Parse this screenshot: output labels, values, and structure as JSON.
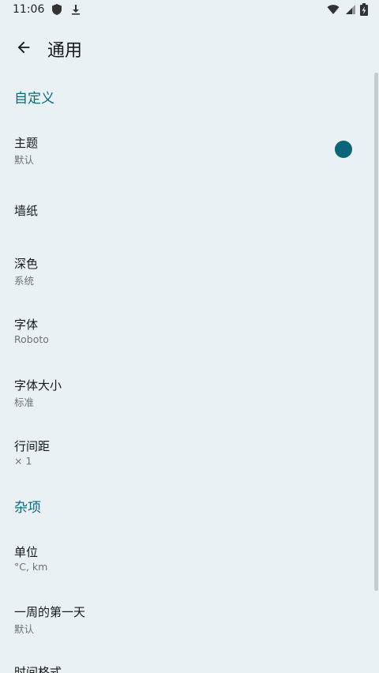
{
  "status_bar": {
    "time": "11:06",
    "icons": [
      "shield-icon",
      "download-icon",
      "wifi-icon",
      "signal-icon",
      "battery-charging-icon"
    ]
  },
  "appbar": {
    "back_icon": "arrow-left-icon",
    "title": "通用"
  },
  "sections": [
    {
      "header": "自定义",
      "items": [
        {
          "title": "主题",
          "subtitle": "默认",
          "color": "#0b6579"
        },
        {
          "title": "墙纸",
          "subtitle": ""
        },
        {
          "title": "深色",
          "subtitle": "系统"
        },
        {
          "title": "字体",
          "subtitle": "Roboto"
        },
        {
          "title": "字体大小",
          "subtitle": "标准"
        },
        {
          "title": "行间距",
          "subtitle": "× 1"
        }
      ]
    },
    {
      "header": "杂项",
      "items": [
        {
          "title": "单位",
          "subtitle": "°C, km"
        },
        {
          "title": "一周的第一天",
          "subtitle": "默认"
        },
        {
          "title": "时间格式",
          "subtitle": ""
        }
      ]
    }
  ],
  "colors": {
    "background": "#e9f1f4",
    "accent": "#0a6b7b"
  }
}
